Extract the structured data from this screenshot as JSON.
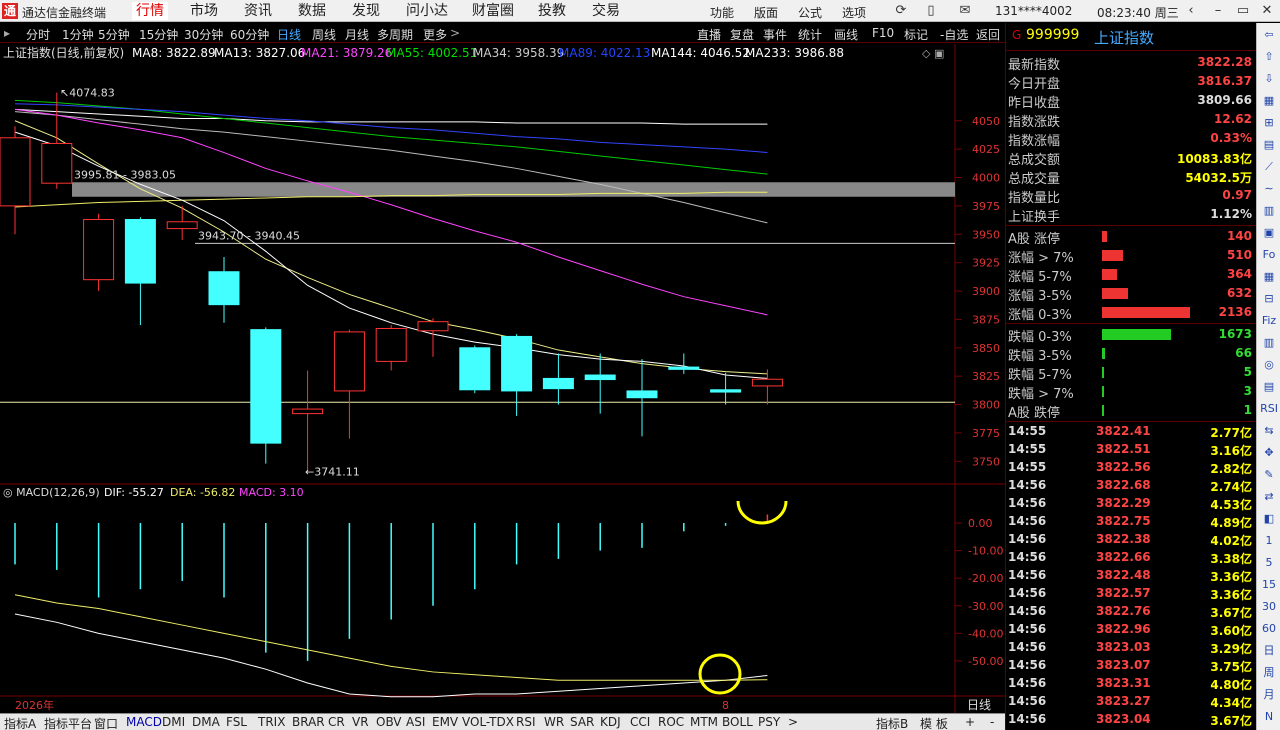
{
  "app": {
    "title": "通达信金融终端",
    "menus": [
      "行情",
      "市场",
      "资讯",
      "数据",
      "发现",
      "问小达",
      "财富圈",
      "投教",
      "交易"
    ],
    "active_menu": "行情",
    "right_menus": [
      "功能",
      "版面",
      "公式",
      "选项"
    ],
    "user": "131****4002",
    "clock": "08:23:40 周三"
  },
  "toolbar": {
    "periods": [
      "分时",
      "1分钟",
      "5分钟",
      "15分钟",
      "30分钟",
      "60分钟",
      "日线",
      "周线",
      "月线",
      "多周期",
      "更多"
    ],
    "active_period": "日线",
    "more_glyph": ">",
    "actions": [
      "直播",
      "复盘",
      "事件",
      "统计",
      "画线",
      "F10",
      "标记",
      "-自选",
      "返回"
    ]
  },
  "chart_data": {
    "type": "candlestick",
    "title": "上证指数(日线,前复权)",
    "ma_legend": [
      {
        "label": "MA8: 3822.89",
        "color": "#ffffff"
      },
      {
        "label": "MA13: 3827.06",
        "color": "#ffffff"
      },
      {
        "label": "MA21: 3879.26",
        "color": "#ff44ff"
      },
      {
        "label": "MA55: 4002.51",
        "color": "#00dd00"
      },
      {
        "label": "MA34: 3958.39",
        "color": "#cccccc"
      },
      {
        "label": "MA89: 4022.13",
        "color": "#2244ff"
      },
      {
        "label": "MA144: 4046.52",
        "color": "#ffffff"
      },
      {
        "label": "MA233: 3986.88",
        "color": "#ffffff"
      }
    ],
    "y_ticks": [
      4050,
      4025,
      4000,
      3975,
      3950,
      3925,
      3900,
      3875,
      3850,
      3825,
      3800,
      3775,
      3750
    ],
    "ylim": [
      3730,
      4100
    ],
    "candles": [
      {
        "o": 3975,
        "c": 4035,
        "h": 4045,
        "l": 3950
      },
      {
        "o": 3995,
        "c": 4030,
        "h": 4074.83,
        "l": 3990
      },
      {
        "o": 3910,
        "c": 3963,
        "h": 3968,
        "l": 3900
      },
      {
        "o": 3963,
        "c": 3907,
        "h": 3965,
        "l": 3870
      },
      {
        "o": 3955,
        "c": 3961,
        "h": 3975,
        "l": 3945
      },
      {
        "o": 3917,
        "c": 3888,
        "h": 3930,
        "l": 3872
      },
      {
        "o": 3866,
        "c": 3766,
        "h": 3868,
        "l": 3748
      },
      {
        "o": 3792,
        "c": 3796,
        "h": 3830,
        "l": 3741.11
      },
      {
        "o": 3812,
        "c": 3864,
        "h": 3866,
        "l": 3770
      },
      {
        "o": 3838,
        "c": 3867,
        "h": 3870,
        "l": 3830
      },
      {
        "o": 3865,
        "c": 3873,
        "h": 3876,
        "l": 3842
      },
      {
        "o": 3850,
        "c": 3813,
        "h": 3852,
        "l": 3810
      },
      {
        "o": 3860,
        "c": 3812,
        "h": 3862,
        "l": 3790
      },
      {
        "o": 3823,
        "c": 3814,
        "h": 3845,
        "l": 3800
      },
      {
        "o": 3826,
        "c": 3822,
        "h": 3845,
        "l": 3792
      },
      {
        "o": 3812,
        "c": 3806,
        "h": 3840,
        "l": 3772
      },
      {
        "o": 3833,
        "c": 3831,
        "h": 3845,
        "l": 3827
      },
      {
        "o": 3813,
        "c": 3811,
        "h": 3828,
        "l": 3800
      },
      {
        "o": 3816.37,
        "c": 3822.28,
        "h": 3831,
        "l": 3800
      }
    ],
    "ma_lines": [
      {
        "color": "#ffffff",
        "values": [
          4060,
          4058,
          4056,
          4054,
          4052,
          4052,
          4050,
          4049,
          4049,
          4049,
          4049,
          4049,
          4048,
          4048,
          4048,
          4048,
          4047,
          4047,
          4047
        ]
      },
      {
        "color": "#00cc00",
        "values": [
          4068,
          4066,
          4063,
          4060,
          4056,
          4052,
          4048,
          4044,
          4040,
          4036,
          4033,
          4030,
          4027,
          4023,
          4019,
          4015,
          4011,
          4007,
          4003
        ]
      },
      {
        "color": "#3344ff",
        "values": [
          4065,
          4064,
          4062,
          4060,
          4058,
          4055,
          4052,
          4050,
          4047,
          4044,
          4042,
          4039,
          4036,
          4034,
          4031,
          4029,
          4027,
          4025,
          4022
        ]
      },
      {
        "color": "#bbbbbb",
        "values": [
          4058,
          4055,
          4051,
          4047,
          4043,
          4040,
          4036,
          4032,
          4028,
          4024,
          4019,
          4014,
          4008,
          4001,
          3994,
          3986,
          3978,
          3969,
          3960
        ]
      },
      {
        "color": "#ff44ff",
        "values": [
          4060,
          4055,
          4048,
          4042,
          4035,
          4022,
          4008,
          3997,
          3987,
          3976,
          3964,
          3953,
          3943,
          3930,
          3918,
          3906,
          3895,
          3887,
          3879
        ]
      },
      {
        "color": "#eeee66",
        "values": [
          3974,
          3976,
          3978,
          3979,
          3980,
          3981,
          3982,
          3983,
          3983,
          3984,
          3984,
          3985,
          3985,
          3985,
          3986,
          3986,
          3986,
          3987,
          3987
        ]
      },
      {
        "color": "#eeee88",
        "values": [
          4050,
          4035,
          4012,
          3990,
          3973,
          3952,
          3928,
          3912,
          3897,
          3885,
          3873,
          3866,
          3858,
          3848,
          3842,
          3836,
          3832,
          3829,
          3827
        ]
      },
      {
        "color": "#ffffff",
        "values": [
          4040,
          4028,
          4010,
          3994,
          3980,
          3962,
          3935,
          3905,
          3885,
          3872,
          3862,
          3855,
          3850,
          3844,
          3840,
          3838,
          3834,
          3826,
          3823
        ]
      }
    ],
    "annotations": {
      "high": "4074.83",
      "low": "←3741.11",
      "zone": "3995.81 - 3983.05",
      "zone2": "3943.70 - 3940.45"
    },
    "macd": {
      "title": "MACD(12,26,9)",
      "dif_label": "DIF: -55.27",
      "dea_label": "DEA: -56.82",
      "macd_label": "MACD: 3.10",
      "y_ticks": [
        "0.00",
        "-10.00",
        "-20.00",
        "-30.00",
        "-40.00",
        "-50.00"
      ],
      "ylim": [
        -62,
        4
      ],
      "bars": [
        -15,
        -17,
        -27,
        -24,
        -21,
        -27,
        -47,
        -50,
        -42,
        -35,
        -30,
        -24,
        -15,
        -13,
        -10,
        -9,
        -3,
        -1,
        3.1
      ],
      "dif": [
        -33,
        -36,
        -40,
        -43,
        -46,
        -49,
        -53,
        -58,
        -62,
        -63,
        -63,
        -62,
        -62,
        -61,
        -60,
        -59,
        -58,
        -57,
        -55.27
      ],
      "dea": [
        -26,
        -29,
        -31,
        -34,
        -37,
        -40,
        -43,
        -46,
        -49,
        -52,
        -54,
        -55,
        -56,
        -57,
        -57,
        -57,
        -57,
        -57,
        -56.82
      ]
    },
    "x_labels": {
      "year": "2026年",
      "month": "8"
    }
  },
  "side": {
    "g_label": "G",
    "code": "999999",
    "name": "上证指数",
    "quotes": [
      {
        "label": "最新指数",
        "value": "3822.28",
        "color": "#ff4444"
      },
      {
        "label": "今日开盘",
        "value": "3816.37",
        "color": "#ff4444"
      },
      {
        "label": "昨日收盘",
        "value": "3809.66",
        "color": "#dddddd"
      },
      {
        "label": "指数涨跌",
        "value": "12.62",
        "color": "#ff4444"
      },
      {
        "label": "指数涨幅",
        "value": "0.33%",
        "color": "#ff4444"
      },
      {
        "label": "总成交额",
        "value": "10083.83亿",
        "color": "#ffff00"
      },
      {
        "label": "总成交量",
        "value": "54032.5万",
        "color": "#ffff00"
      },
      {
        "label": "指数量比",
        "value": "0.97",
        "color": "#ff4444"
      },
      {
        "label": "上证换手",
        "value": "1.12%",
        "color": "#dddddd"
      }
    ],
    "breadth_up": [
      {
        "label": "A股 涨停",
        "value": "140",
        "frac": 0.06
      },
      {
        "label": "涨幅 > 7%",
        "value": "510",
        "frac": 0.24
      },
      {
        "label": "涨幅 5-7%",
        "value": "364",
        "frac": 0.17
      },
      {
        "label": "涨幅 3-5%",
        "value": "632",
        "frac": 0.3
      },
      {
        "label": "涨幅 0-3%",
        "value": "2136",
        "frac": 1.0
      }
    ],
    "breadth_down": [
      {
        "label": "跌幅 0-3%",
        "value": "1673",
        "frac": 0.78
      },
      {
        "label": "跌幅 3-5%",
        "value": "66",
        "frac": 0.03
      },
      {
        "label": "跌幅 5-7%",
        "value": "5",
        "frac": 0.01
      },
      {
        "label": "跌幅 > 7%",
        "value": "3",
        "frac": 0.01
      },
      {
        "label": "A股 跌停",
        "value": "1",
        "frac": 0.01
      }
    ],
    "ticks": [
      {
        "t": "14:55",
        "p": "3822.41",
        "a": "2.77亿"
      },
      {
        "t": "14:55",
        "p": "3822.51",
        "a": "3.16亿"
      },
      {
        "t": "14:55",
        "p": "3822.56",
        "a": "2.82亿"
      },
      {
        "t": "14:56",
        "p": "3822.68",
        "a": "2.74亿"
      },
      {
        "t": "14:56",
        "p": "3822.29",
        "a": "4.53亿"
      },
      {
        "t": "14:56",
        "p": "3822.75",
        "a": "4.89亿"
      },
      {
        "t": "14:56",
        "p": "3822.38",
        "a": "4.02亿"
      },
      {
        "t": "14:56",
        "p": "3822.66",
        "a": "3.38亿"
      },
      {
        "t": "14:56",
        "p": "3822.48",
        "a": "3.36亿"
      },
      {
        "t": "14:56",
        "p": "3822.57",
        "a": "3.36亿"
      },
      {
        "t": "14:56",
        "p": "3822.76",
        "a": "3.67亿"
      },
      {
        "t": "14:56",
        "p": "3822.96",
        "a": "3.60亿"
      },
      {
        "t": "14:56",
        "p": "3823.03",
        "a": "3.29亿"
      },
      {
        "t": "14:56",
        "p": "3823.07",
        "a": "3.75亿"
      },
      {
        "t": "14:56",
        "p": "3823.31",
        "a": "4.80亿"
      },
      {
        "t": "14:56",
        "p": "3823.27",
        "a": "4.34亿"
      },
      {
        "t": "14:56",
        "p": "3823.04",
        "a": "3.67亿"
      }
    ]
  },
  "rtools": [
    "⇦",
    "⇧",
    "⇩",
    "▦",
    "⊞",
    "▤",
    "⟋",
    "∼",
    "▥",
    "▣",
    "Fo",
    "▦",
    "⊟",
    "Fiz",
    "▥",
    "◎",
    "▤",
    "RSI",
    "⇆",
    "✥",
    "✎",
    "⇄",
    "◧",
    "1",
    "5",
    "15",
    "30",
    "60",
    "日",
    "周",
    "月",
    "N"
  ],
  "bottom": {
    "tabs": [
      "指标A",
      "指标平台",
      "窗口",
      "MACD",
      "DMI",
      "DMA",
      "FSL",
      "TRIX",
      "BRAR",
      "CR",
      "VR",
      "OBV",
      "ASI",
      "EMV",
      "VOL-TDX",
      "RSI",
      "WR",
      "SAR",
      "KDJ",
      "CCI",
      "ROC",
      "MTM",
      "BOLL",
      "PSY",
      ">"
    ],
    "active": "MACD",
    "right": [
      "指标B",
      "模 板",
      "+",
      "-"
    ],
    "day_label": "日线"
  }
}
